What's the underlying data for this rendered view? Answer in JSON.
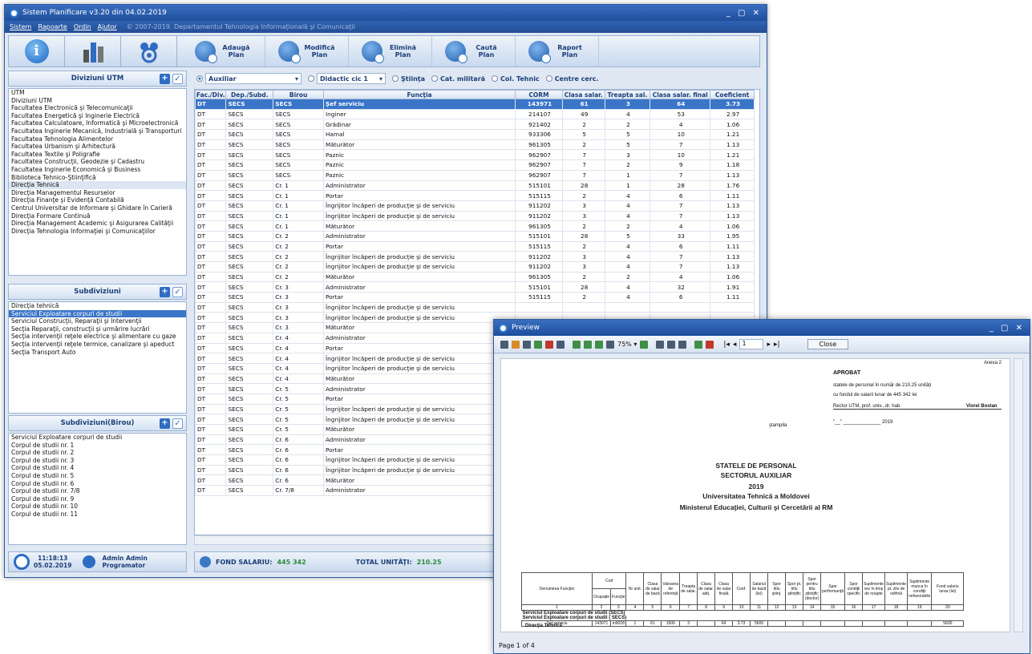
{
  "main_window": {
    "title": "Sistem Planificare v3.20 din 04.02.2019",
    "controls": "_ ▢ ✕",
    "menu": [
      "Sistem",
      "Rapoarte",
      "Ordin",
      "Ajutor"
    ],
    "copyright": "© 2007-2019. Departamentul Tehnologia Informaţională şi Comunicaţii",
    "toolbar": [
      {
        "label": "Adaugă\nPlan",
        "icon": "add-plan-icon"
      },
      {
        "label": "Modifică\nPlan",
        "icon": "edit-plan-icon"
      },
      {
        "label": "Elimină\nPlan",
        "icon": "remove-plan-icon"
      },
      {
        "label": "Caută\nPlan",
        "icon": "search-plan-icon"
      },
      {
        "label": "Raport\nPlan",
        "icon": "report-plan-icon"
      }
    ]
  },
  "divisions": {
    "header": "Diviziuni UTM",
    "items": [
      "UTM",
      "Diviziuni UTM",
      "Facultatea Electronică şi Telecomunicaţii",
      "Facultatea Energetică şi Inginerie Electrică",
      "Facultatea Calculatoare, Informatică şi Microelectronică",
      "Facultatea Inginerie Mecanică, Industrială şi Transporturi",
      "Facultatea Tehnologia Alimentelor",
      "Facultatea Urbanism şi Arhitectură",
      "Facultatea Textile şi Poligrafie",
      "Facultatea Construcţii, Geodezie şi Cadastru",
      "Facultatea Inginerie Economică şi Business",
      "Biblioteca Tehnico-Ştiinţifică",
      "Direcţia Tehnică",
      "Direcţia Managementul Resurselor",
      "Direcţia Finanţe şi Evidenţă Contabilă",
      "Centrul Universitar de Informare şi Ghidare în Carieră",
      "Direcţia Formare Continuă",
      "Direcţia Management Academic şi Asigurarea Calităţii",
      "Direcţia Tehnologia Informaţiei şi Comunicaţiilor"
    ],
    "selected": 12
  },
  "subdivisions": {
    "header": "Subdiviziuni",
    "items": [
      "Direcţia tehnică",
      "Serviciul Exploatare corpuri de studii",
      "Serviciul Construcţii, Reparaţii şi Intervenţii",
      "Secţia Reparaţii, construcţii şi urmărire lucrări",
      "Secţia intervenţii reţele electrice şi alimentare cu gaze",
      "Secţia intervenţii reţele termice, canalizare şi apeduct",
      "Secţia Transport Auto"
    ],
    "selected": 1
  },
  "birou": {
    "header": "Subdiviziuni(Birou)",
    "items": [
      "Serviciul Exploatare corpuri de studii",
      "Corpul de studii nr. 1",
      "Corpul de studii nr. 2",
      "Corpul de studii nr. 3",
      "Corpul de studii nr. 4",
      "Corpul de studii nr. 5",
      "Corpul de studii nr. 6",
      "Corpul de studii nr. 7/8",
      "Corpul de studii nr. 9",
      "Corpul de studii nr. 10",
      "Corpul de studii nr. 11"
    ]
  },
  "filters": {
    "auxiliar": "Auxiliar",
    "didactic": "Didactic cic 1",
    "options": [
      "Ştiinţa",
      "Cat. militară",
      "Col. Tehnic",
      "Centre cerc."
    ]
  },
  "grid": {
    "columns": [
      "Fac./Div.",
      "Dep./Subd.",
      "Birou",
      "Funcţia",
      "CORM",
      "Clasa salar.",
      "Treapta sal.",
      "Clasa salar. final",
      "Coeficient"
    ],
    "rows": [
      [
        "DT",
        "SECS",
        "SECS",
        "Şef serviciu",
        "143971",
        "61",
        "3",
        "64",
        "3.73"
      ],
      [
        "DT",
        "SECS",
        "SECS",
        "Inginer",
        "214107",
        "49",
        "4",
        "53",
        "2.97"
      ],
      [
        "DT",
        "SECS",
        "SECS",
        "Grădinar",
        "921402",
        "2",
        "2",
        "4",
        "1.06"
      ],
      [
        "DT",
        "SECS",
        "SECS",
        "Hamal",
        "933306",
        "5",
        "5",
        "10",
        "1.21"
      ],
      [
        "DT",
        "SECS",
        "SECS",
        "Măturător",
        "961305",
        "2",
        "5",
        "7",
        "1.13"
      ],
      [
        "DT",
        "SECS",
        "SECS",
        "Paznic",
        "962907",
        "7",
        "3",
        "10",
        "1.21"
      ],
      [
        "DT",
        "SECS",
        "SECS",
        "Paznic",
        "962907",
        "7",
        "2",
        "9",
        "1.18"
      ],
      [
        "DT",
        "SECS",
        "SECS",
        "Paznic",
        "962907",
        "7",
        "1",
        "7",
        "1.13"
      ],
      [
        "DT",
        "SECS",
        "Cr. 1",
        "Administrator",
        "515101",
        "28",
        "1",
        "28",
        "1.76"
      ],
      [
        "DT",
        "SECS",
        "Cr. 1",
        "Portar",
        "515115",
        "2",
        "4",
        "6",
        "1.11"
      ],
      [
        "DT",
        "SECS",
        "Cr. 1",
        "Îngrijitor încăperi de producţie şi de serviciu",
        "911202",
        "3",
        "4",
        "7",
        "1.13"
      ],
      [
        "DT",
        "SECS",
        "Cr. 1",
        "Îngrijitor încăperi de producţie şi de serviciu",
        "911202",
        "3",
        "4",
        "7",
        "1.13"
      ],
      [
        "DT",
        "SECS",
        "Cr. 1",
        "Măturător",
        "961305",
        "2",
        "2",
        "4",
        "1.06"
      ],
      [
        "DT",
        "SECS",
        "Cr. 2",
        "Administrator",
        "515101",
        "28",
        "5",
        "33",
        "1.95"
      ],
      [
        "DT",
        "SECS",
        "Cr. 2",
        "Portar",
        "515115",
        "2",
        "4",
        "6",
        "1.11"
      ],
      [
        "DT",
        "SECS",
        "Cr. 2",
        "Îngrijitor încăperi de producţie şi de serviciu",
        "911202",
        "3",
        "4",
        "7",
        "1.13"
      ],
      [
        "DT",
        "SECS",
        "Cr. 2",
        "Îngrijitor încăperi de producţie şi de serviciu",
        "911202",
        "3",
        "4",
        "7",
        "1.13"
      ],
      [
        "DT",
        "SECS",
        "Cr. 2",
        "Măturător",
        "961305",
        "2",
        "2",
        "4",
        "1.06"
      ],
      [
        "DT",
        "SECS",
        "Cr. 3",
        "Administrator",
        "515101",
        "28",
        "4",
        "32",
        "1.91"
      ],
      [
        "DT",
        "SECS",
        "Cr. 3",
        "Portar",
        "515115",
        "2",
        "4",
        "6",
        "1.11"
      ],
      [
        "DT",
        "SECS",
        "Cr. 3",
        "Îngrijitor încăperi de producţie şi de serviciu",
        "",
        "",
        "",
        "",
        ""
      ],
      [
        "DT",
        "SECS",
        "Cr. 3",
        "Îngrijitor încăperi de producţie şi de serviciu",
        "",
        "",
        "",
        "",
        ""
      ],
      [
        "DT",
        "SECS",
        "Cr. 3",
        "Măturător",
        "",
        "",
        "",
        "",
        ""
      ],
      [
        "DT",
        "SECS",
        "Cr. 4",
        "Administrator",
        "",
        "",
        "",
        "",
        ""
      ],
      [
        "DT",
        "SECS",
        "Cr. 4",
        "Portar",
        "",
        "",
        "",
        "",
        ""
      ],
      [
        "DT",
        "SECS",
        "Cr. 4",
        "Îngrijitor încăperi de producţie şi de serviciu",
        "",
        "",
        "",
        "",
        ""
      ],
      [
        "DT",
        "SECS",
        "Cr. 4",
        "Îngrijitor încăperi de producţie şi de serviciu",
        "",
        "",
        "",
        "",
        ""
      ],
      [
        "DT",
        "SECS",
        "Cr. 4",
        "Măturător",
        "",
        "",
        "",
        "",
        ""
      ],
      [
        "DT",
        "SECS",
        "Cr. 5",
        "Administrator",
        "",
        "",
        "",
        "",
        ""
      ],
      [
        "DT",
        "SECS",
        "Cr. 5",
        "Portar",
        "",
        "",
        "",
        "",
        ""
      ],
      [
        "DT",
        "SECS",
        "Cr. 5",
        "Îngrijitor încăperi de producţie şi de serviciu",
        "",
        "",
        "",
        "",
        ""
      ],
      [
        "DT",
        "SECS",
        "Cr. 5",
        "Îngrijitor încăperi de producţie şi de serviciu",
        "",
        "",
        "",
        "",
        ""
      ],
      [
        "DT",
        "SECS",
        "Cr. 5",
        "Măturător",
        "",
        "",
        "",
        "",
        ""
      ],
      [
        "DT",
        "SECS",
        "Cr. 6",
        "Administrator",
        "",
        "",
        "",
        "",
        ""
      ],
      [
        "DT",
        "SECS",
        "Cr. 6",
        "Portar",
        "",
        "",
        "",
        "",
        ""
      ],
      [
        "DT",
        "SECS",
        "Cr. 6",
        "Îngrijitor încăperi de producţie şi de serviciu",
        "",
        "",
        "",
        "",
        ""
      ],
      [
        "DT",
        "SECS",
        "Cr. 6",
        "Îngrijitor încăperi de producţie şi de serviciu",
        "",
        "",
        "",
        "",
        ""
      ],
      [
        "DT",
        "SECS",
        "Cr. 6",
        "Măturător",
        "",
        "",
        "",
        "",
        ""
      ],
      [
        "DT",
        "SECS",
        "Cr. 7/8",
        "Administrator",
        "",
        "",
        "",
        "",
        ""
      ]
    ]
  },
  "status": {
    "time": "11:18:13",
    "date": "05.02.2019",
    "user": "Admin Admin",
    "role": "Programator",
    "fond_label": "FOND SALARIU:",
    "fond_value": "445 342",
    "total_label": "TOTAL UNITĂŢI:",
    "total_value": "210.25"
  },
  "preview": {
    "title": "Preview",
    "zoom": "75%",
    "page_input": "1",
    "close": "Close",
    "page_status": "Page 1 of 4",
    "annex": "Anexa 2",
    "approved": "APROBAT",
    "approve_line1": "statele de personal în număr de 210.25 unităţi",
    "approve_line2": "cu fondul de salarii lunar de 445 342 lei",
    "rector": "Rector UTM, prof. univ., dr. hab.",
    "rector_name": "Viorel Bostan",
    "stamp": "ştampila",
    "date_line": "\"__\" ______________ 2019",
    "title1": "STATELE DE PERSONAL",
    "title2": "SECTORUL AUXILIAR",
    "year": "2019",
    "uni": "Universitatea Tehnică a Moldovei",
    "ministry": "Ministerul Educaţiei, Culturii şi Cercetării al RM",
    "table_head": [
      "Denumirea Funcţiei",
      "Ocupaţie",
      "Funcţie",
      "Nr unit.",
      "Clasa de salar de bază",
      "Valoarea de referinţă",
      "Treapta de salar.",
      "Clasa de salar. adiţ.",
      "Clasa de salar finală",
      "Coef.",
      "Salariul de bază (lei)",
      "Spor titlu ştiinţ.",
      "Spor pt. titlu ştiinţific",
      "Spor pentru titlu ştiinţific (doctor)",
      "Spor performanţă",
      "Spor condiţii specific",
      "Suplimente ore în timp de noapte",
      "Suplimente pt. zile de odihnă",
      "Suplimente munca în condiţii nefavorabile",
      "Fond salariu lunar (lei)"
    ],
    "cod": "Cod",
    "col_nums": [
      "1",
      "2",
      "3",
      "4",
      "5",
      "6",
      "7",
      "8",
      "9",
      "10",
      "11",
      "12",
      "13",
      "14",
      "15",
      "16",
      "17",
      "18",
      "19",
      "20"
    ],
    "sec1": "Direcţia Tehnică",
    "sec2": "Serviciul Exploatare corpuri de studii (SECS)",
    "sec3": "Serviciul Exploatare corpuri de studii ( SECS)",
    "first_row": [
      "Şef serviciu",
      "143971",
      "m9028",
      "1",
      "61",
      "1500",
      "3",
      "",
      "64",
      "3.73",
      "5600",
      "",
      "",
      "",
      "",
      "",
      "",
      "",
      "",
      "5600"
    ]
  }
}
